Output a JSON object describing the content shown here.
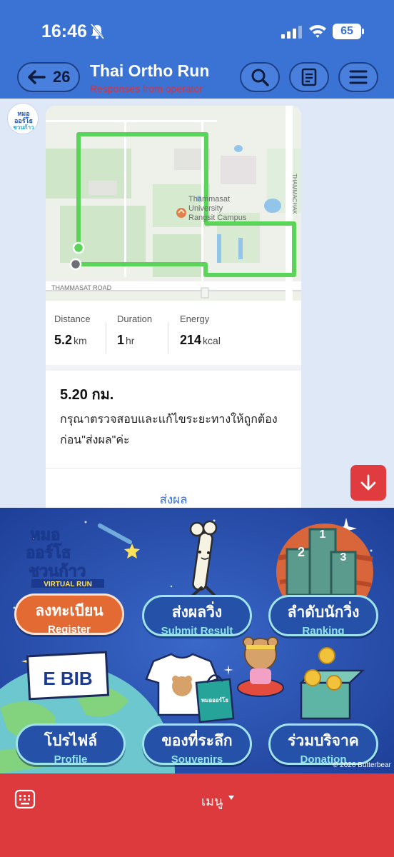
{
  "status_bar": {
    "time": "16:46",
    "battery": "65"
  },
  "header": {
    "back_count": "26",
    "title": "Thai Ortho Run",
    "subtitle": "Responses from operator"
  },
  "chat": {
    "avatar_text": "หมอออร์โธชวนก้าว",
    "map": {
      "campus_line1": "Thammasat",
      "campus_line2": "University",
      "campus_line3": "Rangsit Campus",
      "road_bottom": "THAMMASAT ROAD",
      "road_right": "THAMMACHAK"
    },
    "stats": {
      "distance_label": "Distance",
      "distance_value": "5.2",
      "distance_unit": "km",
      "duration_label": "Duration",
      "duration_value": "1",
      "duration_unit": "hr",
      "energy_label": "Energy",
      "energy_value": "214",
      "energy_unit": "kcal"
    },
    "message_title": "5.20 กม.",
    "message_body": "กรุณาตรวจสอบและแก้ไขระยะทางให้ถูกต้องก่อน\"ส่งผล\"ค่ะ",
    "action_link": "ส่งผล"
  },
  "rich_menu": {
    "logo_line1": "หมอ",
    "logo_line2": "ออร์โธ",
    "logo_line3": "ชวนก้าว",
    "logo_badge": "VIRTUAL RUN",
    "ebib_text": "E BIB",
    "souvenir_logo": "หมอออร์โธ",
    "podium": [
      "1",
      "2",
      "3"
    ],
    "buttons": [
      {
        "th": "ลงทะเบียน",
        "en": "Register"
      },
      {
        "th": "ส่งผลวิ่ง",
        "en": "Submit Result"
      },
      {
        "th": "ลำดับนักวิ่ง",
        "en": "Ranking"
      },
      {
        "th": "โปรไฟล์",
        "en": "Profile"
      },
      {
        "th": "ของที่ระลึก",
        "en": "Souvenirs"
      },
      {
        "th": "ร่วมบริจาค",
        "en": "Donation"
      }
    ],
    "copyright": "© 2026 Butterbear"
  },
  "bottom_bar": {
    "label": "เมนู"
  },
  "colors": {
    "header_blue": "#3b73d4",
    "chat_bg": "#dfe8f6",
    "route_green": "#5ad55a",
    "bottom_red": "#dc3a3d",
    "menu_blue": "#2d54b9"
  }
}
